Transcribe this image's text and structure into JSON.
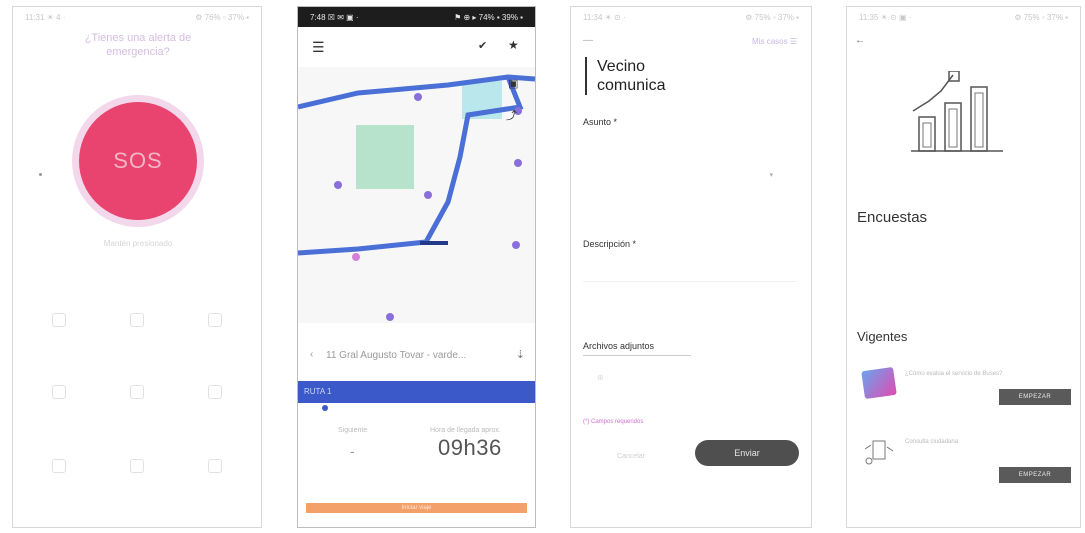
{
  "screen1": {
    "status_time": "11:31 ☀ 4 ·",
    "status_right": "⚙ 76% ▫ 37% ▪",
    "question": "¿Tienes una alerta de emergencia?",
    "sos_label": "SOS",
    "hint": "Mantén presionado",
    "shortcuts": [
      "",
      "",
      "",
      "",
      "",
      "",
      "",
      "",
      ""
    ]
  },
  "screen2": {
    "status_time": "7:48 ☒ ✉ ▣ ·",
    "status_right": "⚑ ⊕ ▸ 74% ▪ 39% ▪",
    "search_text": "11 Gral Augusto Tovar - varde...",
    "route_label": "RUTA 1",
    "label_left": "Siguiente",
    "label_right": "Hora de llegada aprox.",
    "value_left": "-",
    "time_value": "09h36",
    "button_label": "Iniciar viaje"
  },
  "screen3": {
    "status_time": "11:34 ☀ ⊙ ·",
    "status_right": "⚙ 75% ▫ 37% ▪",
    "top_link": "Mis casos",
    "title": "Vecino comunica",
    "asunto_label": "Asunto *",
    "options": [
      "",
      "",
      "",
      ""
    ],
    "description_label": "Descripción *",
    "description_placeholder": "",
    "attachments_label": "Archivos adjuntos",
    "error_text": "(*) Campos requeridos",
    "cancel_label": "Cancelar",
    "send_label": "Enviar"
  },
  "screen4": {
    "status_time": "11:35 ☀ ⊙ ▣ ·",
    "status_right": "⚙ 75% ▫ 37% ▪",
    "heading": "Encuestas",
    "intro": "",
    "note": "",
    "subheading": "Vigentes",
    "surveys": [
      {
        "title": "¿Cómo evalúa el servicio de Buses?",
        "action": "EMPEZAR"
      },
      {
        "title": "Consulta ciudadana",
        "action": "EMPEZAR"
      }
    ]
  },
  "colors": {
    "sos_red": "#e8446f",
    "route_blue": "#3b59c9",
    "button_dark": "#4f4f4f",
    "accent_orange": "#f4a06a"
  }
}
